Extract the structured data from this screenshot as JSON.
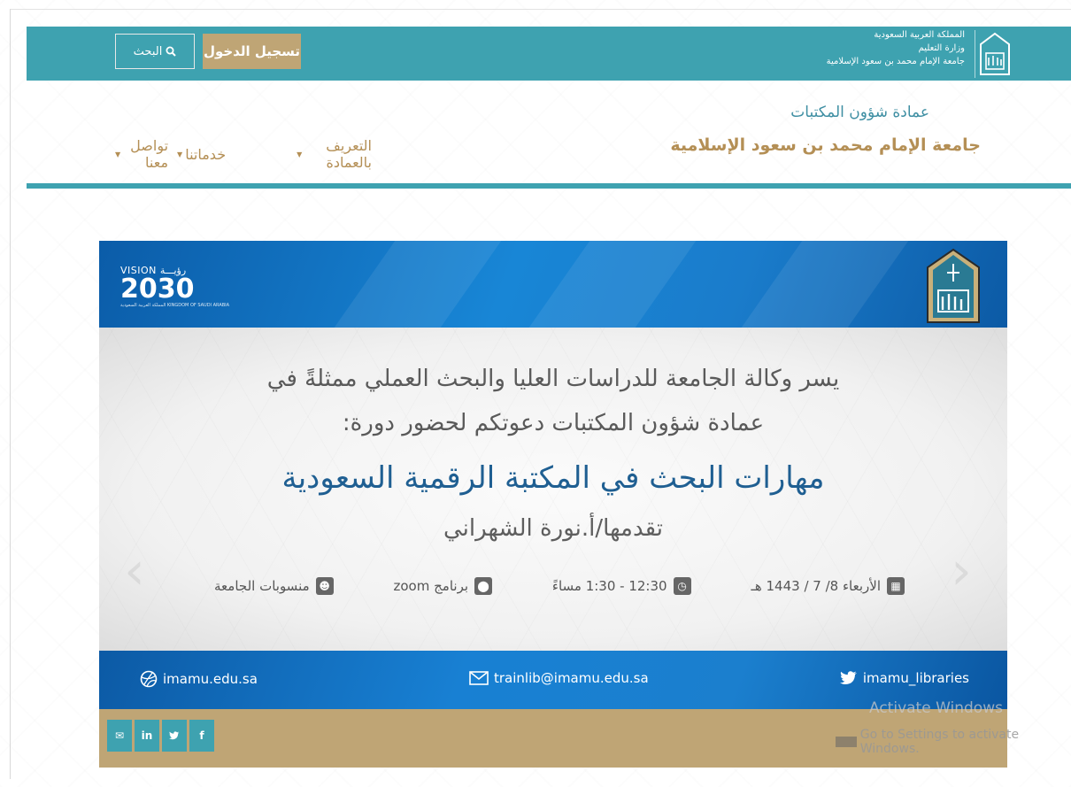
{
  "topbar": {
    "gov_lines": [
      "المملكة العربية السعودية",
      "وزارة التعليم",
      "جامعة الإمام محمد بن سعود الإسلامية"
    ],
    "login_label": "تسجيل الدخول",
    "search_label": "البحث",
    "bg_color": "#3ea2b0",
    "accent_color": "#bfa575"
  },
  "header": {
    "dept_title": "عمادة شؤون المكتبات",
    "university": "جامعة الإمام محمد بن سعود الإسلامية",
    "nav": [
      {
        "label": "التعريف بالعمادة"
      },
      {
        "label": "خدماتنا"
      },
      {
        "label": "تواصل معنا"
      }
    ]
  },
  "poster": {
    "vision_small": "VISION رؤيـــة",
    "vision_year": "2030",
    "vision_caption": "المملكة العربية السعودية KINGDOM OF SAUDI ARABIA",
    "logo_text": "إمام",
    "intro_line1": "يسر وكالة الجامعة للدراسات العليا والبحث العملي ممثلةً في",
    "intro_line2": "عمادة شؤون المكتبات دعوتكم لحضور دورة:",
    "course_title": "مهارات البحث في المكتبة الرقمية السعودية",
    "presenter": "تقدمها/أ.نورة الشهراني",
    "details": {
      "date": "الأربعاء 8/ 7 / 1443 هـ",
      "time": "12:30 - 1:30 مساءً",
      "platform": "برنامج zoom",
      "audience": "منسوبات الجامعة"
    },
    "contact": {
      "website": "imamu.edu.sa",
      "email": "trainlib@imamu.edu.sa",
      "twitter": "imamu_libraries"
    }
  },
  "footer": {
    "socials": [
      {
        "icon": "mail-icon",
        "glyph": "✉"
      },
      {
        "icon": "linkedin-icon",
        "glyph": "in"
      },
      {
        "icon": "twitter-icon",
        "glyph": "🐦"
      },
      {
        "icon": "facebook-icon",
        "glyph": "f"
      }
    ]
  },
  "watermark": {
    "line1": "Activate Windows",
    "line2": "Go to Settings to activate Windows."
  }
}
